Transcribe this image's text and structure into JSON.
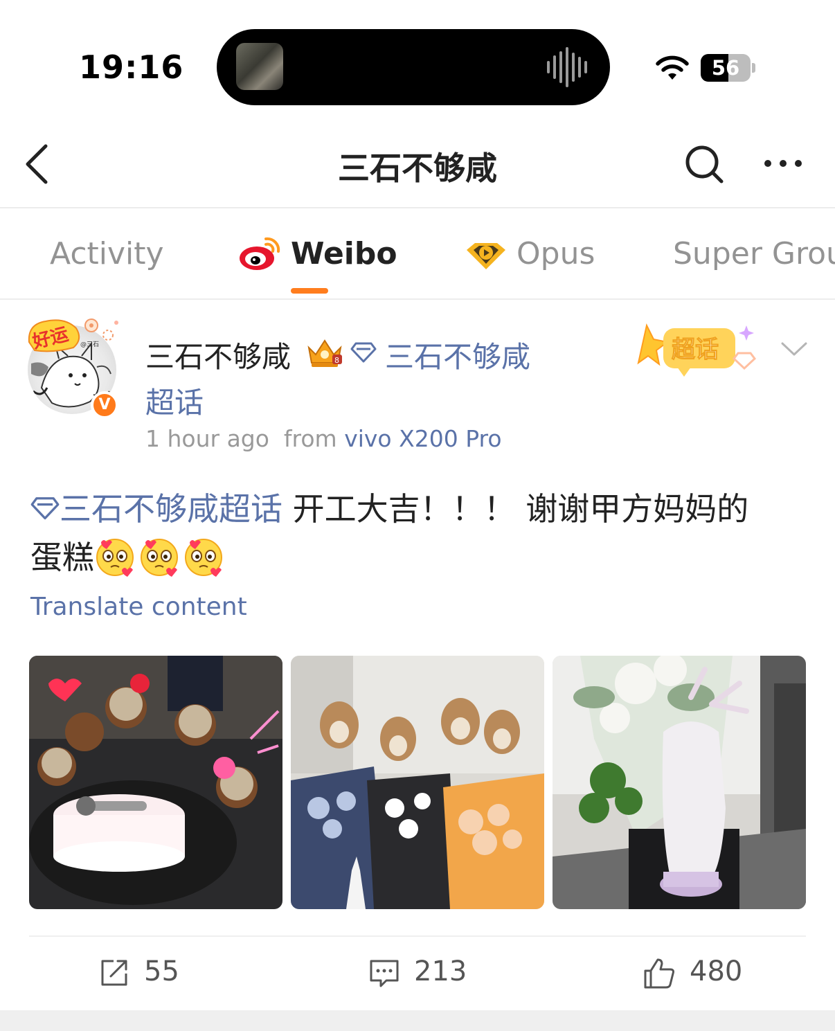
{
  "status_bar": {
    "time": "19:16",
    "battery": "56",
    "battery_level": 0.56,
    "icons": [
      "wifi-icon",
      "battery-icon",
      "audio-wave-icon"
    ]
  },
  "nav": {
    "title": "三石不够咸",
    "icons": [
      "back-icon",
      "search-icon",
      "more-icon"
    ]
  },
  "tabs": {
    "items": [
      {
        "label": "Activity",
        "active": false
      },
      {
        "label": "Weibo",
        "active": true,
        "icon": "weibo-logo-icon"
      },
      {
        "label": "Opus",
        "active": false,
        "icon": "opus-play-icon"
      },
      {
        "label": "Super Grou",
        "active": false
      }
    ],
    "accent": "#ff7d1e"
  },
  "post": {
    "username": "三石不够咸",
    "supertopic_line1": "三石不够咸",
    "supertopic_line2": "超话",
    "time_ago": "1 hour ago",
    "from_label": "from",
    "source": "vivo X200 Pro",
    "badge_label": "超话",
    "avatar_sticker_text": "好运",
    "verified_symbol": "V",
    "text_topic": "三石不够咸超话",
    "text_line1_rest": " 开工大吉！！！ 谢谢甲方妈妈的",
    "text_line2": "蛋糕",
    "emoji_count": 3,
    "translate": "Translate content",
    "images": [
      {
        "name": "photo-cakes",
        "subject": "cat cakes with microphone"
      },
      {
        "name": "photo-plush-bouquets",
        "subject": "plush deer toys and bouquets"
      },
      {
        "name": "photo-deer-statue",
        "subject": "white deer statue and flowers"
      }
    ],
    "actions": {
      "reposts": "55",
      "comments": "213",
      "likes": "480"
    },
    "link_color": "#5a72a8"
  }
}
